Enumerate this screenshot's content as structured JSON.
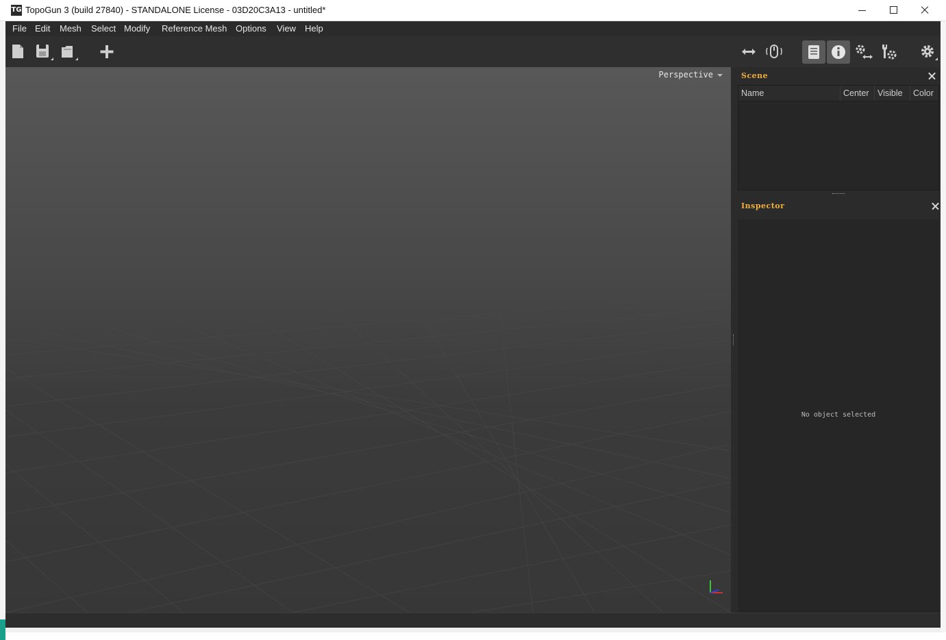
{
  "window": {
    "logo_text": "TG",
    "title": "TopoGun 3 (build 27840) - STANDALONE License - 03D20C3A13 - untitled*",
    "controls": [
      "minimize-icon",
      "maximize-icon",
      "close-icon"
    ]
  },
  "menubar": {
    "items": [
      "File",
      "Edit",
      "Mesh",
      "Select",
      "Modify",
      "Reference Mesh",
      "Options",
      "View",
      "Help"
    ]
  },
  "toolbar": {
    "left_icons": [
      "new-file-icon",
      "save-icon",
      "open-file-icon",
      "add-icon"
    ],
    "right_icons": [
      "move-arrows-icon",
      "mouse-icon",
      "scene-panel-icon",
      "inspector-info-icon",
      "gizmo-settings-icon",
      "tool-settings-icon",
      "preferences-gear-icon"
    ],
    "active_toggles": [
      "scene-panel-icon",
      "inspector-info-icon"
    ]
  },
  "viewport": {
    "camera_mode": "Perspective"
  },
  "scene_panel": {
    "title": "Scene",
    "columns": [
      "Name",
      "Center",
      "Visible",
      "Color"
    ],
    "rows": []
  },
  "inspector_panel": {
    "title": "Inspector",
    "empty_message": "No object selected"
  },
  "colors": {
    "panel_title": "#f0b040",
    "background": "#2f2f2f",
    "viewport_top": "#585858",
    "viewport_bottom": "#373737"
  }
}
